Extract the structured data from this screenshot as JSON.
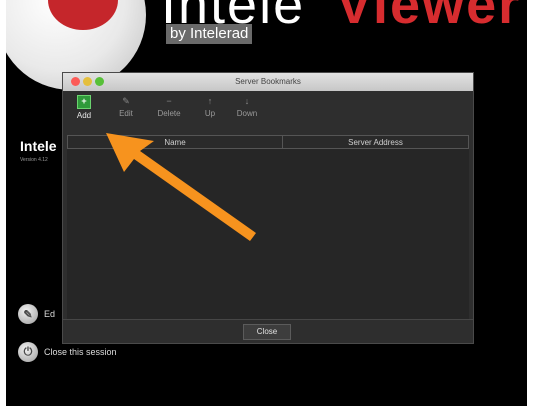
{
  "splash": {
    "brand_suffix": "by Intelerad",
    "product_name_short": "Intele",
    "version_text": "Version 4.12",
    "edit_action_label": "Ed",
    "close_session_label": "Close this session"
  },
  "dialog": {
    "title": "Server Bookmarks",
    "toolbar": {
      "add_label": "Add",
      "edit_label": "Edit",
      "delete_label": "Delete",
      "up_label": "Up",
      "down_label": "Down",
      "add_icon": "+",
      "edit_icon": "✎",
      "delete_icon": "−",
      "up_icon": "↑",
      "down_icon": "↓"
    },
    "table": {
      "columns": [
        "Name",
        "Server Address"
      ],
      "rows": []
    },
    "close_label": "Close"
  },
  "colors": {
    "accent_arrow": "#f7931e",
    "add_green": "#2f9a3a",
    "brand_red": "#d72c2f"
  }
}
